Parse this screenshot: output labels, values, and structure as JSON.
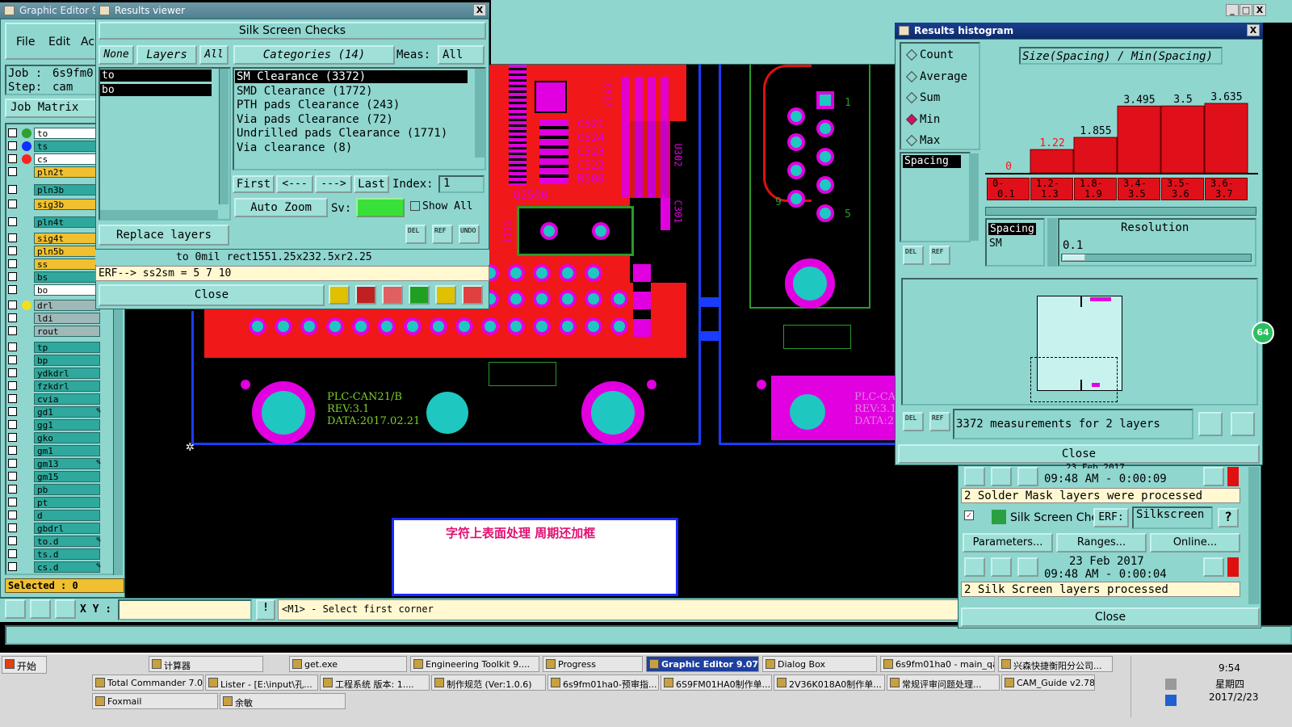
{
  "main_window": {
    "title": "Graphic Editor 9.",
    "menu": [
      "File",
      "Edit",
      "Ac"
    ],
    "job_label": "Job :",
    "job_value": "6s9fm0",
    "step_label": "Step:",
    "step_value": "cam",
    "job_matrix": "Job Matrix",
    "selected_label": "Selected : 0",
    "xy_label": "X Y :",
    "xy_value": "",
    "prompt_marker": "!",
    "status_text": "<M1> - Select first corner",
    "layers": [
      {
        "name": "to",
        "dot": "#2ea02e",
        "bg": "#ffffff",
        "edit": true
      },
      {
        "name": "ts",
        "dot": "#1030ff",
        "bg": "#2fa89d"
      },
      {
        "name": "cs",
        "dot": "#ff2020",
        "bg": "#ffffff"
      },
      {
        "name": "pln2t",
        "bg": "#f0c030"
      },
      {
        "name": "pln3b",
        "bg": "#2fa89d"
      },
      {
        "name": "sig3b",
        "bg": "#f0c030"
      },
      {
        "name": "pln4t",
        "bg": "#2fa89d"
      },
      {
        "name": "sig4t",
        "bg": "#f0c030"
      },
      {
        "name": "pln5b",
        "bg": "#f0c030"
      },
      {
        "name": "ss",
        "bg": "#f0c030"
      },
      {
        "name": "bs",
        "bg": "#2fa89d"
      },
      {
        "name": "bo",
        "bg": "#ffffff"
      },
      {
        "name": "drl",
        "dot": "#f0e020",
        "bg": "#9fb8b8"
      },
      {
        "name": "ldi",
        "bg": "#9fb8b8"
      },
      {
        "name": "rout",
        "bg": "#9fb8b8"
      },
      {
        "name": "tp",
        "bg": "#2fa89d"
      },
      {
        "name": "bp",
        "bg": "#2fa89d"
      },
      {
        "name": "ydkdrl",
        "bg": "#2fa89d"
      },
      {
        "name": "fzkdrl",
        "bg": "#2fa89d"
      },
      {
        "name": "cvia",
        "bg": "#2fa89d"
      },
      {
        "name": "gd1",
        "bg": "#2fa89d",
        "edit": true
      },
      {
        "name": "gg1",
        "bg": "#2fa89d"
      },
      {
        "name": "gko",
        "bg": "#2fa89d"
      },
      {
        "name": "gm1",
        "bg": "#2fa89d"
      },
      {
        "name": "gm13",
        "bg": "#2fa89d",
        "edit": true
      },
      {
        "name": "gm15",
        "bg": "#2fa89d"
      },
      {
        "name": "pb",
        "bg": "#2fa89d"
      },
      {
        "name": "pt",
        "bg": "#2fa89d"
      },
      {
        "name": "d",
        "bg": "#2fa89d"
      },
      {
        "name": "gbdrl",
        "bg": "#2fa89d"
      },
      {
        "name": "to.d",
        "bg": "#2fa89d",
        "edit": true
      },
      {
        "name": "ts.d",
        "bg": "#2fa89d"
      },
      {
        "name": "cs.d",
        "bg": "#2fa89d",
        "edit": true
      }
    ]
  },
  "canvas": {
    "board_text_1": "PLC-CAN21/B",
    "board_text_2": "REV:3.1",
    "board_text_3": "DATA:2017.02.21",
    "board_text_4": "PLC-CA",
    "board_text_5": "REV:3.1",
    "board_text_6": "DATA:2",
    "ref_labels": [
      "C521",
      "C524",
      "C523",
      "C522",
      "R508",
      "Q2500",
      "C517",
      "U302",
      "C301",
      "C111",
      "9",
      "5",
      "1"
    ],
    "note": "字符上表面处理   周期还加框"
  },
  "results_viewer": {
    "title": "Results viewer",
    "close_x": "X",
    "header": "Silk Screen Checks",
    "none_btn": "None",
    "layers_btn": "Layers",
    "all_btn": "All",
    "layer_items": [
      "to",
      "bo"
    ],
    "categories_btn": "Categories (14)",
    "meas_label": "Meas:",
    "meas_value": "All",
    "categories": [
      "SM Clearance (3372)",
      "SMD Clearance (1772)",
      "PTH pads Clearance (243)",
      "Via pads Clearance (72)",
      "Undrilled pads Clearance (1771)",
      "Via clearance (8)"
    ],
    "first_btn": "First",
    "prev_btn": "<---",
    "next_btn": "--->",
    "last_btn": "Last",
    "index_label": "Index:",
    "index_value": "1",
    "auto_zoom": "Auto Zoom",
    "sv_label": "Sv:",
    "show_all": "Show All",
    "replace_layers": "Replace layers",
    "info_line": "to 0mil  rect1551.25x232.5xr2.25",
    "erf_line": "ERF--> ss2sm = 5 7 10",
    "close": "Close",
    "del": "DEL",
    "ref": "REF",
    "undo": "UNDO"
  },
  "histogram": {
    "title": "Results histogram",
    "close_x": "X",
    "options": [
      "Count",
      "Average",
      "Sum",
      "Min",
      "Max"
    ],
    "selected_option": "Min",
    "formula": "Size(Spacing) / Min(Spacing)",
    "chart_data": {
      "type": "bar",
      "categories": [
        "0-0.1",
        "1.2-1.3",
        "1.8-1.9",
        "3.4-3.5",
        "3.5-3.6",
        "3.6-3.7"
      ],
      "values": [
        0,
        1.22,
        1.855,
        3.495,
        3.5,
        3.635
      ],
      "value_labels": [
        "0",
        "1.22",
        "1.855",
        "3.495",
        "3.5",
        "3.635"
      ],
      "category_labels_top": [
        "0-",
        "1.2-",
        "1.8-",
        "3.4-",
        "3.5-",
        "3.6-"
      ],
      "category_labels_bottom": [
        "0.1",
        "1.3",
        "1.9",
        "3.5",
        "3.6",
        "3.7"
      ],
      "color": "#e0101a",
      "label_color": "#ff1010"
    },
    "list_item": "Spacing",
    "spacing_label": "Spacing",
    "sm_label": "SM",
    "resolution_label": "Resolution",
    "resolution_value": "0.1",
    "measurement_text": "3372 measurements for 2 layers",
    "close": "Close",
    "del": "DEL",
    "ref": "REF"
  },
  "checklist": {
    "date_top": "23 Feb 2017",
    "time_top": "09:48 AM - 0:00:09",
    "msg_top": "2 Solder Mask layers were processed",
    "row_label": "Silk Screen Che",
    "erf_label": "ERF:",
    "erf_value": "Silkscreen",
    "help": "?",
    "parameters": "Parameters...",
    "ranges": "Ranges...",
    "online": "Online...",
    "date": "23 Feb 2017",
    "time": "09:48 AM - 0:00:04",
    "msg": "2 Silk Screen layers processed",
    "close": "Close"
  },
  "taskbar": {
    "start": "开始",
    "row1": [
      "计算器",
      "get.exe",
      "Engineering Toolkit 9....",
      "Progress",
      "Graphic Editor 9.07....",
      "Dialog Box",
      "6s9fm01ha0 - main_qa",
      "兴森快捷衡阳分公司..."
    ],
    "row2": [
      "Total Commander 7.0...",
      "Lister - [E:\\input\\孔...",
      "工程系统  版本: 1....",
      "制作规范 (Ver:1.0.6)",
      "6s9fm01ha0-预审指...",
      "6S9FM01HA0制作单...",
      "2V36K018A0制作单...",
      "常规评审问题处理...",
      "CAM_Guide v2.78"
    ],
    "row3": [
      "Foxmail",
      "余敏"
    ],
    "clock_time": "9:54",
    "clock_day": "星期四",
    "clock_date": "2017/2/23"
  },
  "misc": {
    "badge": "64"
  }
}
